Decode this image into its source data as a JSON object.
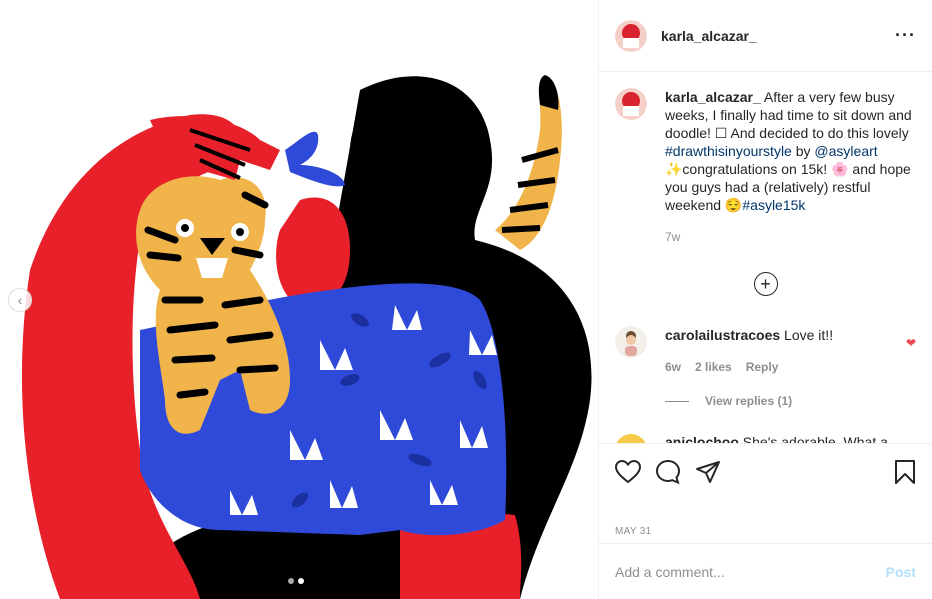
{
  "post": {
    "author": "karla_alcazar_",
    "more_icon": "more-options-icon",
    "caption": {
      "username": "karla_alcazar_",
      "text_1": " After a very few busy weeks, I finally had time to sit down and doodle! ☐ And decided to do this lovely ",
      "hashtag_1": "#drawthisinyourstyle",
      "text_2": " by ",
      "mention": "@asyleart",
      "text_3": " ✨congratulations on 15k! 🌸 and hope you guys had a (relatively) restful weekend 😌",
      "hashtag_2": "#asyle15k",
      "time": "7w"
    },
    "load_more_icon": "plus-circle-icon",
    "comments": [
      {
        "username": "carolailustracoes",
        "text": " Love it!!",
        "time": "6w",
        "likes": "2 likes",
        "reply": "Reply",
        "view_replies": "View replies (1)"
      },
      {
        "username": "aniclochoo",
        "text": " She's adorable. What a"
      }
    ],
    "date": "MAY 31",
    "add_comment_placeholder": "Add a comment...",
    "post_button": "Post",
    "carousel": {
      "slides": 2,
      "active_index": 1
    }
  }
}
